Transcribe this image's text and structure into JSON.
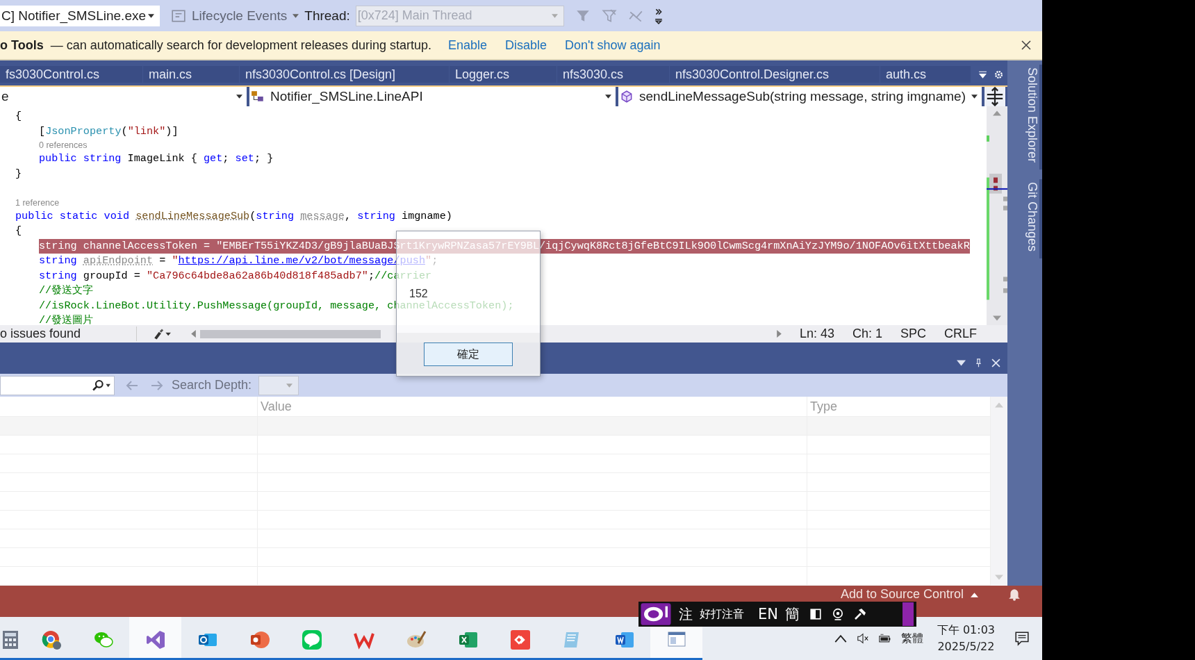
{
  "toolbar": {
    "process": "C] Notifier_SMSLine.exe",
    "lifecycle": "Lifecycle Events",
    "thread_label": "Thread:",
    "thread": "[0x724] Main Thread"
  },
  "info_bar": {
    "title": "o Tools",
    "message": "— can automatically search for development releases during startup.",
    "links": [
      "Enable",
      "Disable",
      "Don't show again"
    ]
  },
  "tabs": [
    {
      "label": "fs3030Control.cs",
      "selected": false
    },
    {
      "label": "main.cs",
      "selected": false
    },
    {
      "label": "nfs3030Control.cs [Design]",
      "selected": false
    },
    {
      "label": "Logger.cs",
      "selected": false
    },
    {
      "label": "nfs3030.cs",
      "selected": false
    },
    {
      "label": "nfs3030Control.Designer.cs",
      "selected": false
    },
    {
      "label": "auth.cs",
      "selected": false
    }
  ],
  "nav_bar": {
    "project": "e",
    "class": "Notifier_SMSLine.LineAPI",
    "member": "sendLineMessageSub(string message, string imgname)"
  },
  "code_lines": [
    {
      "kind": "code",
      "indented": false,
      "highlighted": false,
      "tokens": [
        {
          "kind": "plain",
          "text": "{"
        }
      ]
    },
    {
      "kind": "code",
      "indented": true,
      "highlighted": false,
      "tokens": [
        {
          "kind": "plain",
          "text": "["
        },
        {
          "kind": "type",
          "text": "JsonProperty"
        },
        {
          "kind": "plain",
          "text": "("
        },
        {
          "kind": "string",
          "text": "\"link\""
        },
        {
          "kind": "plain",
          "text": ")]"
        }
      ]
    },
    {
      "kind": "lens",
      "indented": true,
      "text": "0 references"
    },
    {
      "kind": "code",
      "indented": true,
      "highlighted": false,
      "tokens": [
        {
          "kind": "keyword",
          "text": "public string "
        },
        {
          "kind": "plain",
          "text": "ImageLink { "
        },
        {
          "kind": "keyword",
          "text": "get"
        },
        {
          "kind": "plain",
          "text": "; "
        },
        {
          "kind": "keyword",
          "text": "set"
        },
        {
          "kind": "plain",
          "text": "; }"
        }
      ]
    },
    {
      "kind": "code",
      "indented": false,
      "highlighted": false,
      "tokens": [
        {
          "kind": "plain",
          "text": "}"
        }
      ]
    },
    {
      "kind": "blank"
    },
    {
      "kind": "lens",
      "indented": false,
      "text": "1 reference"
    },
    {
      "kind": "code",
      "indented": false,
      "highlighted": false,
      "tokens": [
        {
          "kind": "keyword",
          "text": "public static void "
        },
        {
          "kind": "method",
          "text": "sendLineMessageSub"
        },
        {
          "kind": "plain",
          "text": "("
        },
        {
          "kind": "keyword",
          "text": "string "
        },
        {
          "kind": "unused",
          "text": "message"
        },
        {
          "kind": "plain",
          "text": ", "
        },
        {
          "kind": "keyword",
          "text": "string "
        },
        {
          "kind": "plain",
          "text": "imgname)"
        }
      ]
    },
    {
      "kind": "code",
      "indented": false,
      "highlighted": false,
      "tokens": [
        {
          "kind": "plain",
          "text": "{"
        }
      ]
    },
    {
      "kind": "code",
      "indented": true,
      "highlighted": true,
      "tokens": [
        {
          "kind": "plain",
          "text": "string channelAccessToken = \"EMBErT55iYKZ4D3/gB9jlaBUaBJSrt1KrywRPNZasa57rEY9BL/iqjCywqK8Rct8jGfeBtC9ILk9O0lCwmScg4rmXnAiYzJYM9o/1NOFAOv6itXttbeakR"
        }
      ]
    },
    {
      "kind": "code",
      "indented": true,
      "highlighted": false,
      "tokens": [
        {
          "kind": "keyword",
          "text": "string "
        },
        {
          "kind": "unused",
          "text": "apiEndpoint"
        },
        {
          "kind": "plain",
          "text": " = "
        },
        {
          "kind": "string",
          "text": "\""
        },
        {
          "kind": "link",
          "text": "https://api.line.me/v2/bot/message/push"
        },
        {
          "kind": "string",
          "text": "\""
        },
        {
          "kind": "plain",
          "text": ";"
        }
      ]
    },
    {
      "kind": "code",
      "indented": true,
      "highlighted": false,
      "tokens": [
        {
          "kind": "keyword",
          "text": "string "
        },
        {
          "kind": "plain",
          "text": "groupId = "
        },
        {
          "kind": "string",
          "text": "\"Ca796c64bde8a62a86b40d818f485adb7\""
        },
        {
          "kind": "plain",
          "text": ";"
        },
        {
          "kind": "comment",
          "text": "//carrier"
        }
      ]
    },
    {
      "kind": "code",
      "indented": true,
      "highlighted": false,
      "tokens": [
        {
          "kind": "comment",
          "text": "//發送文字"
        }
      ]
    },
    {
      "kind": "code",
      "indented": true,
      "highlighted": false,
      "tokens": [
        {
          "kind": "comment",
          "text": "//isRock.LineBot.Utility.PushMessage(groupId, message, channelAccessToken);"
        }
      ]
    },
    {
      "kind": "code",
      "indented": true,
      "highlighted": false,
      "tokens": [
        {
          "kind": "comment",
          "text": "//發送圖片"
        }
      ]
    }
  ],
  "editor_status": {
    "issues": "o issues found",
    "line": "Ln: 43",
    "column": "Ch: 1",
    "indent": "SPC",
    "line_ending": "CRLF"
  },
  "message_box": {
    "message": "152",
    "button": "確定"
  },
  "panel": {
    "search_depth_label": "Search Depth:",
    "columns": [
      "Value",
      "Type"
    ]
  },
  "side_tabs": [
    "Solution Explorer",
    "Git Changes"
  ],
  "status_bar": {
    "source_control": "Add to Source Control"
  },
  "ime_bar": {
    "mode": "注",
    "name": "好打注音",
    "language": "EN",
    "script": "簡"
  },
  "taskbar": {
    "tray_language": "繁體",
    "time": "下午 01:03",
    "date": "2025/5/22"
  }
}
